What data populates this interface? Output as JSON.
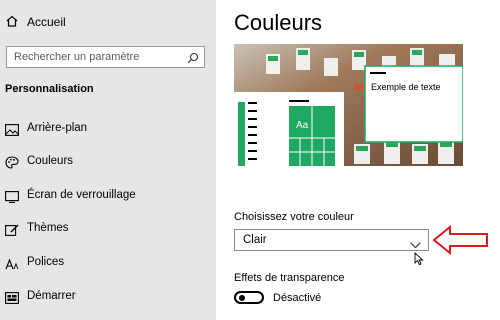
{
  "sidebar": {
    "home_label": "Accueil",
    "search_placeholder": "Rechercher un paramètre",
    "section_title": "Personnalisation",
    "items": [
      {
        "label": "Arrière-plan",
        "icon": "picture-icon"
      },
      {
        "label": "Couleurs",
        "icon": "palette-icon"
      },
      {
        "label": "Écran de verrouillage",
        "icon": "lock-screen-icon"
      },
      {
        "label": "Thèmes",
        "icon": "themes-icon"
      },
      {
        "label": "Polices",
        "icon": "fonts-icon"
      },
      {
        "label": "Démarrer",
        "icon": "start-icon"
      }
    ]
  },
  "main": {
    "title": "Couleurs",
    "preview": {
      "sample_text": "Exemple de texte",
      "tile_text": "Aa",
      "accent_color": "#1fa862"
    },
    "color_choice": {
      "label": "Choisissez votre couleur",
      "value": "Clair"
    },
    "transparency": {
      "label": "Effets de transparence",
      "state": "Désactivé",
      "enabled": false
    }
  },
  "annotation": {
    "arrow_color": "#e0161b"
  }
}
